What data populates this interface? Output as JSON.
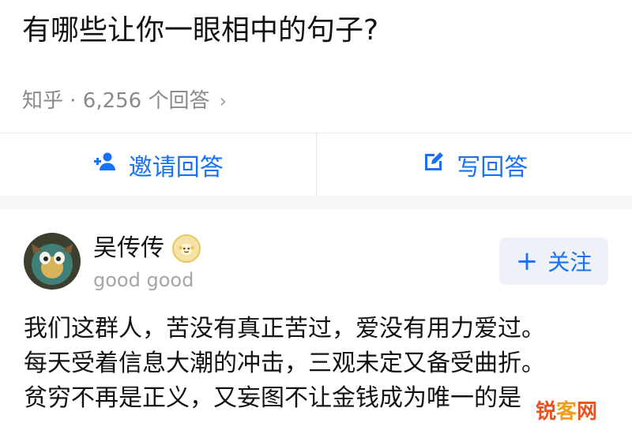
{
  "question": {
    "title": "有哪些让你一眼相中的句子?",
    "meta": "知乎 · 6,256 个回答"
  },
  "actions": {
    "invite_label": "邀请回答",
    "write_label": "写回答",
    "accent": "#1772f6"
  },
  "answer": {
    "author_name": "吴传传",
    "author_bio": "good good",
    "follow_label": "关注",
    "lines": [
      "我们这群人，苦没有真正苦过，爱没有用力爱过。",
      "每天受着信息大潮的冲击，三观未定又备受曲折。",
      "贫穷不再是正义，又妄图不让金钱成为唯一的是"
    ]
  },
  "watermark": {
    "part1": "锐",
    "part2": "客",
    "part3": "网"
  }
}
